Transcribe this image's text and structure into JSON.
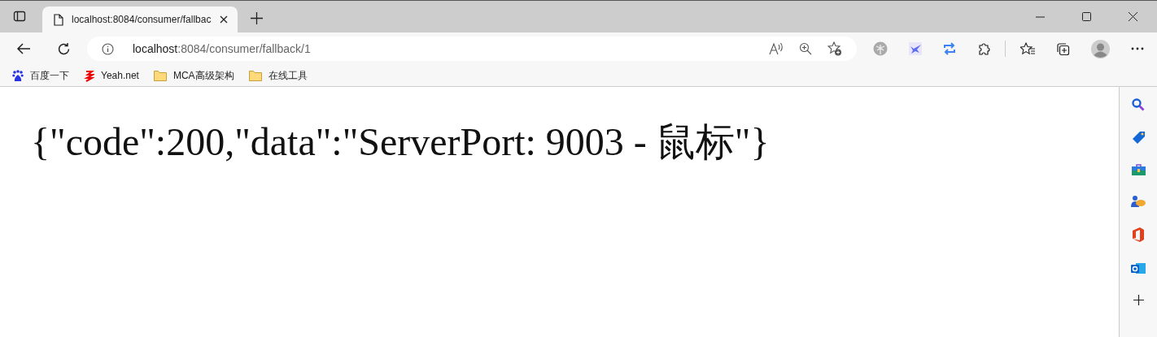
{
  "tabs": [
    {
      "title": "localhost:8084/consumer/fallbac",
      "selected": true
    }
  ],
  "address_bar": {
    "host": "localhost",
    "path": ":8084/consumer/fallback/1"
  },
  "bookmarks": [
    {
      "label": "百度一下",
      "kind": "paw"
    },
    {
      "label": "Yeah.net",
      "kind": "logo"
    },
    {
      "label": "MCA高级架构",
      "kind": "folder"
    },
    {
      "label": "在线工具",
      "kind": "folder"
    }
  ],
  "page": {
    "body": "{\"code\":200,\"data\":\"ServerPort: 9003 - 鼠标\"}"
  }
}
